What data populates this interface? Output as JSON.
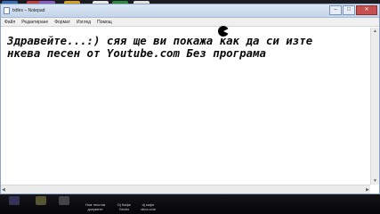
{
  "window": {
    "title": "txtfex – Notepad",
    "controls": {
      "minimize": "–",
      "maximize": "□",
      "close": "✕"
    }
  },
  "menu": {
    "items": [
      "Файл",
      "Редактиране",
      "Формат",
      "Изглед",
      "Помощ"
    ]
  },
  "editor": {
    "line1": "Здравейте...:) сяя ще ви покажа как да си изте",
    "line2": "нкева песен от Youtube.com Без програма"
  },
  "desktop": {
    "bottom_labels": [
      "Нов текстов\nдокумент",
      "Dj Кафе\nGecko",
      "dj кафе\nxbox.com"
    ],
    "accent": "#c3d4e8"
  }
}
